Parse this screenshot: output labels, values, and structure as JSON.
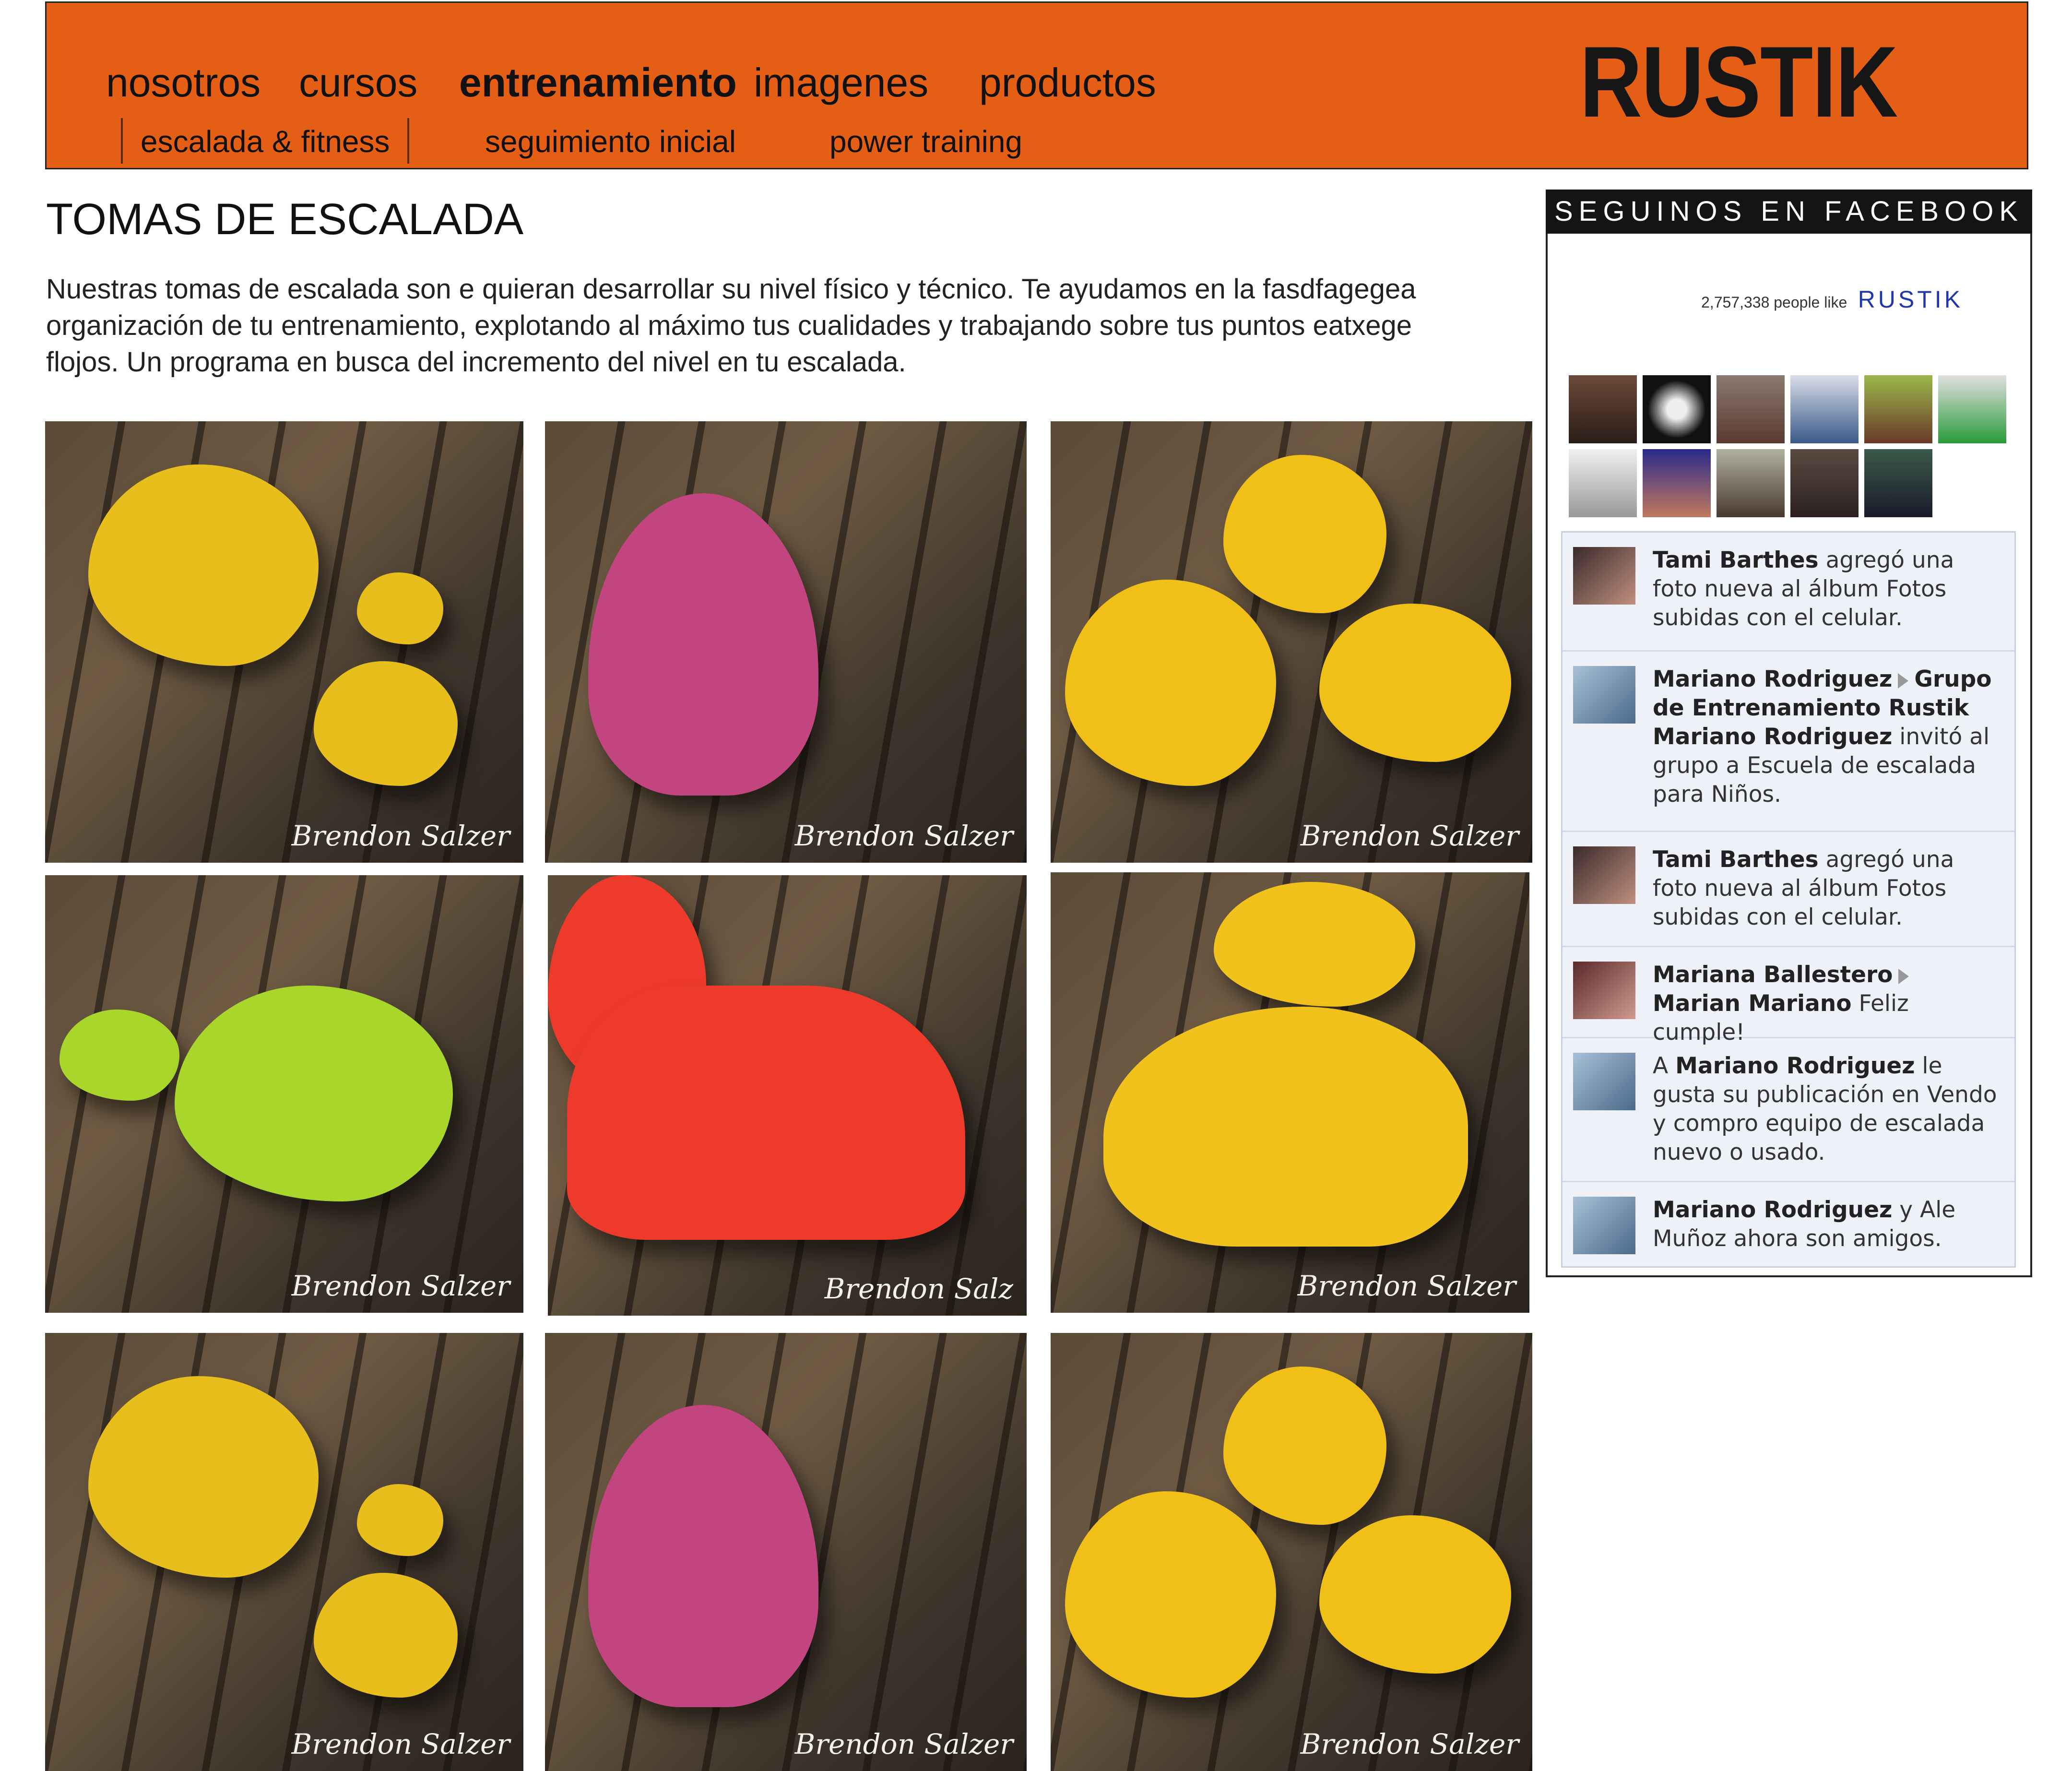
{
  "header": {
    "nav": [
      "nosotros",
      "cursos",
      "entrenamiento",
      "imagenes",
      "productos"
    ],
    "active": "entrenamiento",
    "subnav": [
      "escalada & fitness",
      "seguimiento inicial",
      "power training"
    ],
    "logo": "RUSTIK",
    "bg_color": "#E45E15"
  },
  "main": {
    "title": "TOMAS DE ESCALADA",
    "intro_lines": [
      "Nuestras tomas de escalada son e quieran desarrollar su nivel físico y técnico. Te ayudamos en la fasdfagegea",
      "organización de tu entrenamiento, explotando al máximo tus cualidades y trabajando sobre tus puntos eatxege",
      "flojos. Un programa en busca del incremento del nivel en tu escalada."
    ],
    "photos": [
      {
        "watermark": "Brendon Salzer",
        "hold_color": "#E8BE1C"
      },
      {
        "watermark": "Brendon Salzer",
        "hold_color": "#C2457F"
      },
      {
        "watermark": "Brendon Salzer",
        "hold_color": "#F0BF18"
      },
      {
        "watermark": "Brendon Salzer",
        "hold_color": "#A9D62A"
      },
      {
        "watermark": "Brendon Salz",
        "hold_color": "#EE3A2B"
      },
      {
        "watermark": "Brendon Salzer",
        "hold_color": "#F2C21C"
      },
      {
        "watermark": "Brendon Salzer",
        "hold_color": "#E8BE1C"
      },
      {
        "watermark": "Brendon Salzer",
        "hold_color": "#C2457F"
      },
      {
        "watermark": "Brendon Salzer",
        "hold_color": "#F0BF18"
      }
    ]
  },
  "sidebar": {
    "heading": "SEGUINOS EN FACEBOOK",
    "like_count": "2,757,338 people like",
    "brand": "RUSTIK",
    "feed": [
      {
        "actor": "Tami Barthes",
        "text": " agregó una foto nueva al álbum Fotos subidas con el celular."
      },
      {
        "actor": "Mariano Rodriguez",
        "target": "Grupo de Entrenamiento Rustik Mariano Rodriguez",
        "text": " invitó al grupo a Escuela de escalada para Niños."
      },
      {
        "actor": "Tami Barthes",
        "text": " agregó una foto nueva al álbum Fotos subidas con el celular."
      },
      {
        "actor": "Mariana Ballestero",
        "target": "Marian Mariano",
        "text": " Feliz cumple!"
      },
      {
        "prefix": "A ",
        "actor": "Mariano Rodriguez",
        "text": " le gusta su publicación en Vendo y compro equipo de escalada nuevo o usado."
      },
      {
        "actor": "Mariano Rodriguez",
        "text": " y Ale Muñoz ahora son amigos."
      }
    ]
  }
}
